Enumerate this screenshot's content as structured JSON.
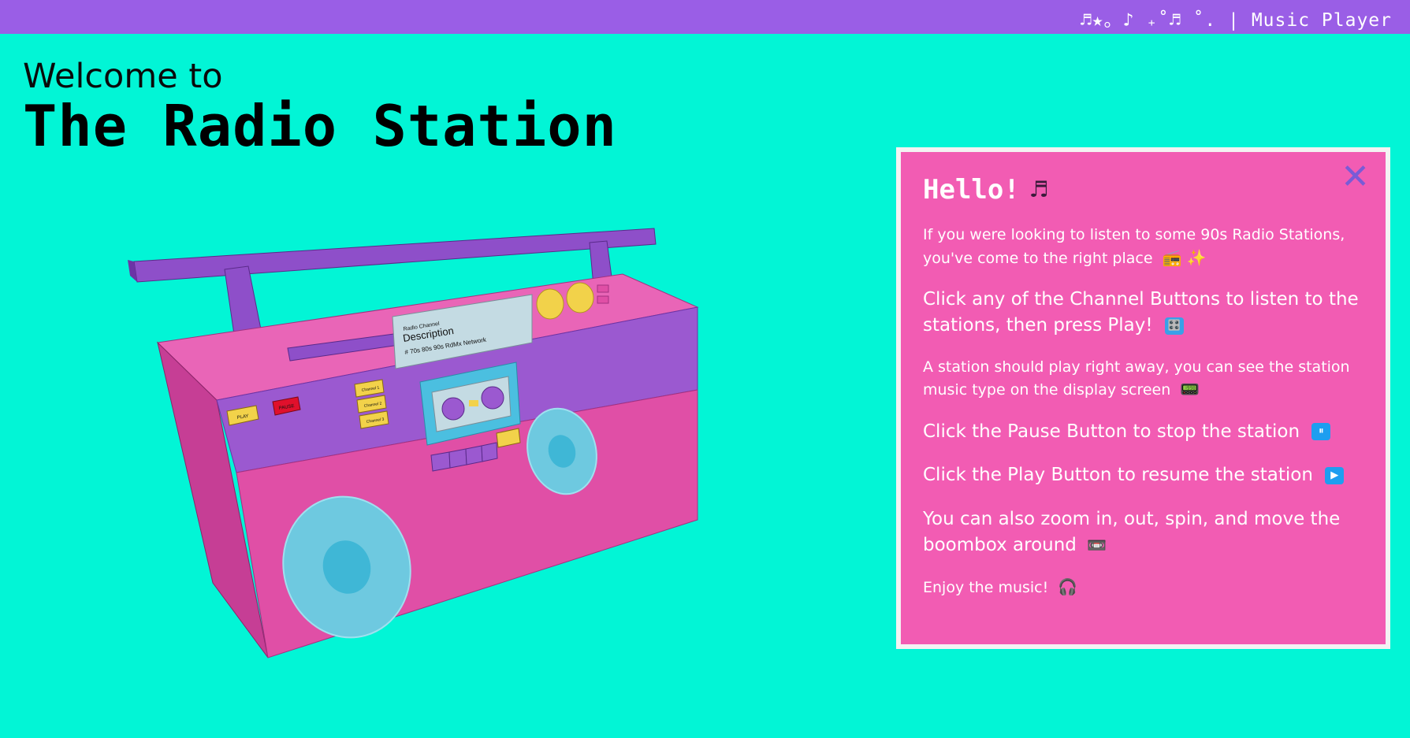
{
  "topbar": {
    "brand": "♬★。♪ ₊˚♬ ˚. | Music Player"
  },
  "header": {
    "welcome": "Welcome to",
    "title": "The Radio Station"
  },
  "boombox": {
    "display": {
      "label": "Radio Channel",
      "title": "Description",
      "subtitle": "# 70s 80s 90s RdMx Network"
    },
    "buttons": {
      "play": "PLAY",
      "pause": "PAUSE"
    },
    "channels": [
      "Channel 1",
      "Channel 2",
      "Channel 3"
    ]
  },
  "panel": {
    "heading": "Hello!",
    "heading_icon": "♬",
    "close": "✕",
    "p1": "If you were looking to listen to some 90s Radio Stations, you've come to the right place",
    "p1_icons": "📻 ✨",
    "p2": "Click any of the Channel Buttons to listen to the stations, then press Play!",
    "p2_icon": "🎛️",
    "p3": "A station should play right away, you can see the station music type on the display screen",
    "p3_icon": "📟",
    "p4": "Click the Pause Button to stop the station",
    "p4_icon": "⏸",
    "p5": "Click the Play Button to resume the station",
    "p5_icon": "▶",
    "p6": "You can also zoom in, out, spin, and move the boombox around",
    "p6_icon": "📼",
    "p7": "Enjoy the music!",
    "p7_icon": "🎧"
  },
  "colors": {
    "background": "#02f5d6",
    "topbar": "#9a5ee6",
    "panel": "#f25cb3",
    "boombox_body": "#e04fa6",
    "boombox_purple": "#9b59d0",
    "speaker": "#6ec9e0",
    "knob": "#f2d24a"
  }
}
